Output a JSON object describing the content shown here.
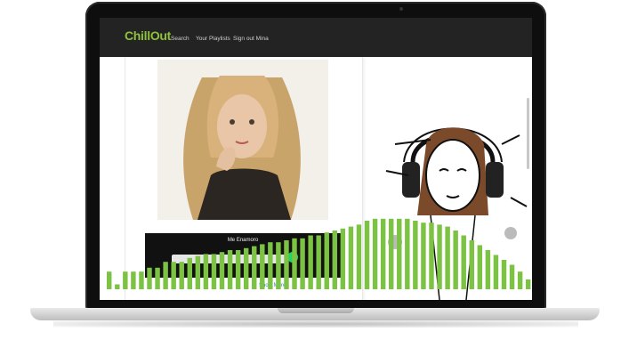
{
  "app": {
    "logo": "ChillOut",
    "nav": [
      {
        "label": "Search"
      },
      {
        "label": "Your Playlists"
      },
      {
        "label": "Sign out Mina"
      }
    ]
  },
  "player": {
    "song_title": "Me Enamoro",
    "footer_link": "Show More"
  },
  "visualizer": {
    "bar_color": "#7cc243",
    "levels": [
      0.18,
      0.05,
      0.18,
      0.18,
      0.18,
      0.22,
      0.22,
      0.28,
      0.28,
      0.28,
      0.32,
      0.34,
      0.36,
      0.36,
      0.38,
      0.4,
      0.4,
      0.42,
      0.44,
      0.46,
      0.48,
      0.48,
      0.5,
      0.52,
      0.52,
      0.55,
      0.55,
      0.58,
      0.6,
      0.62,
      0.64,
      0.66,
      0.7,
      0.72,
      0.72,
      0.72,
      0.72,
      0.72,
      0.7,
      0.68,
      0.68,
      0.66,
      0.64,
      0.6,
      0.55,
      0.5,
      0.45,
      0.4,
      0.35,
      0.3,
      0.25,
      0.18,
      0.1
    ]
  }
}
